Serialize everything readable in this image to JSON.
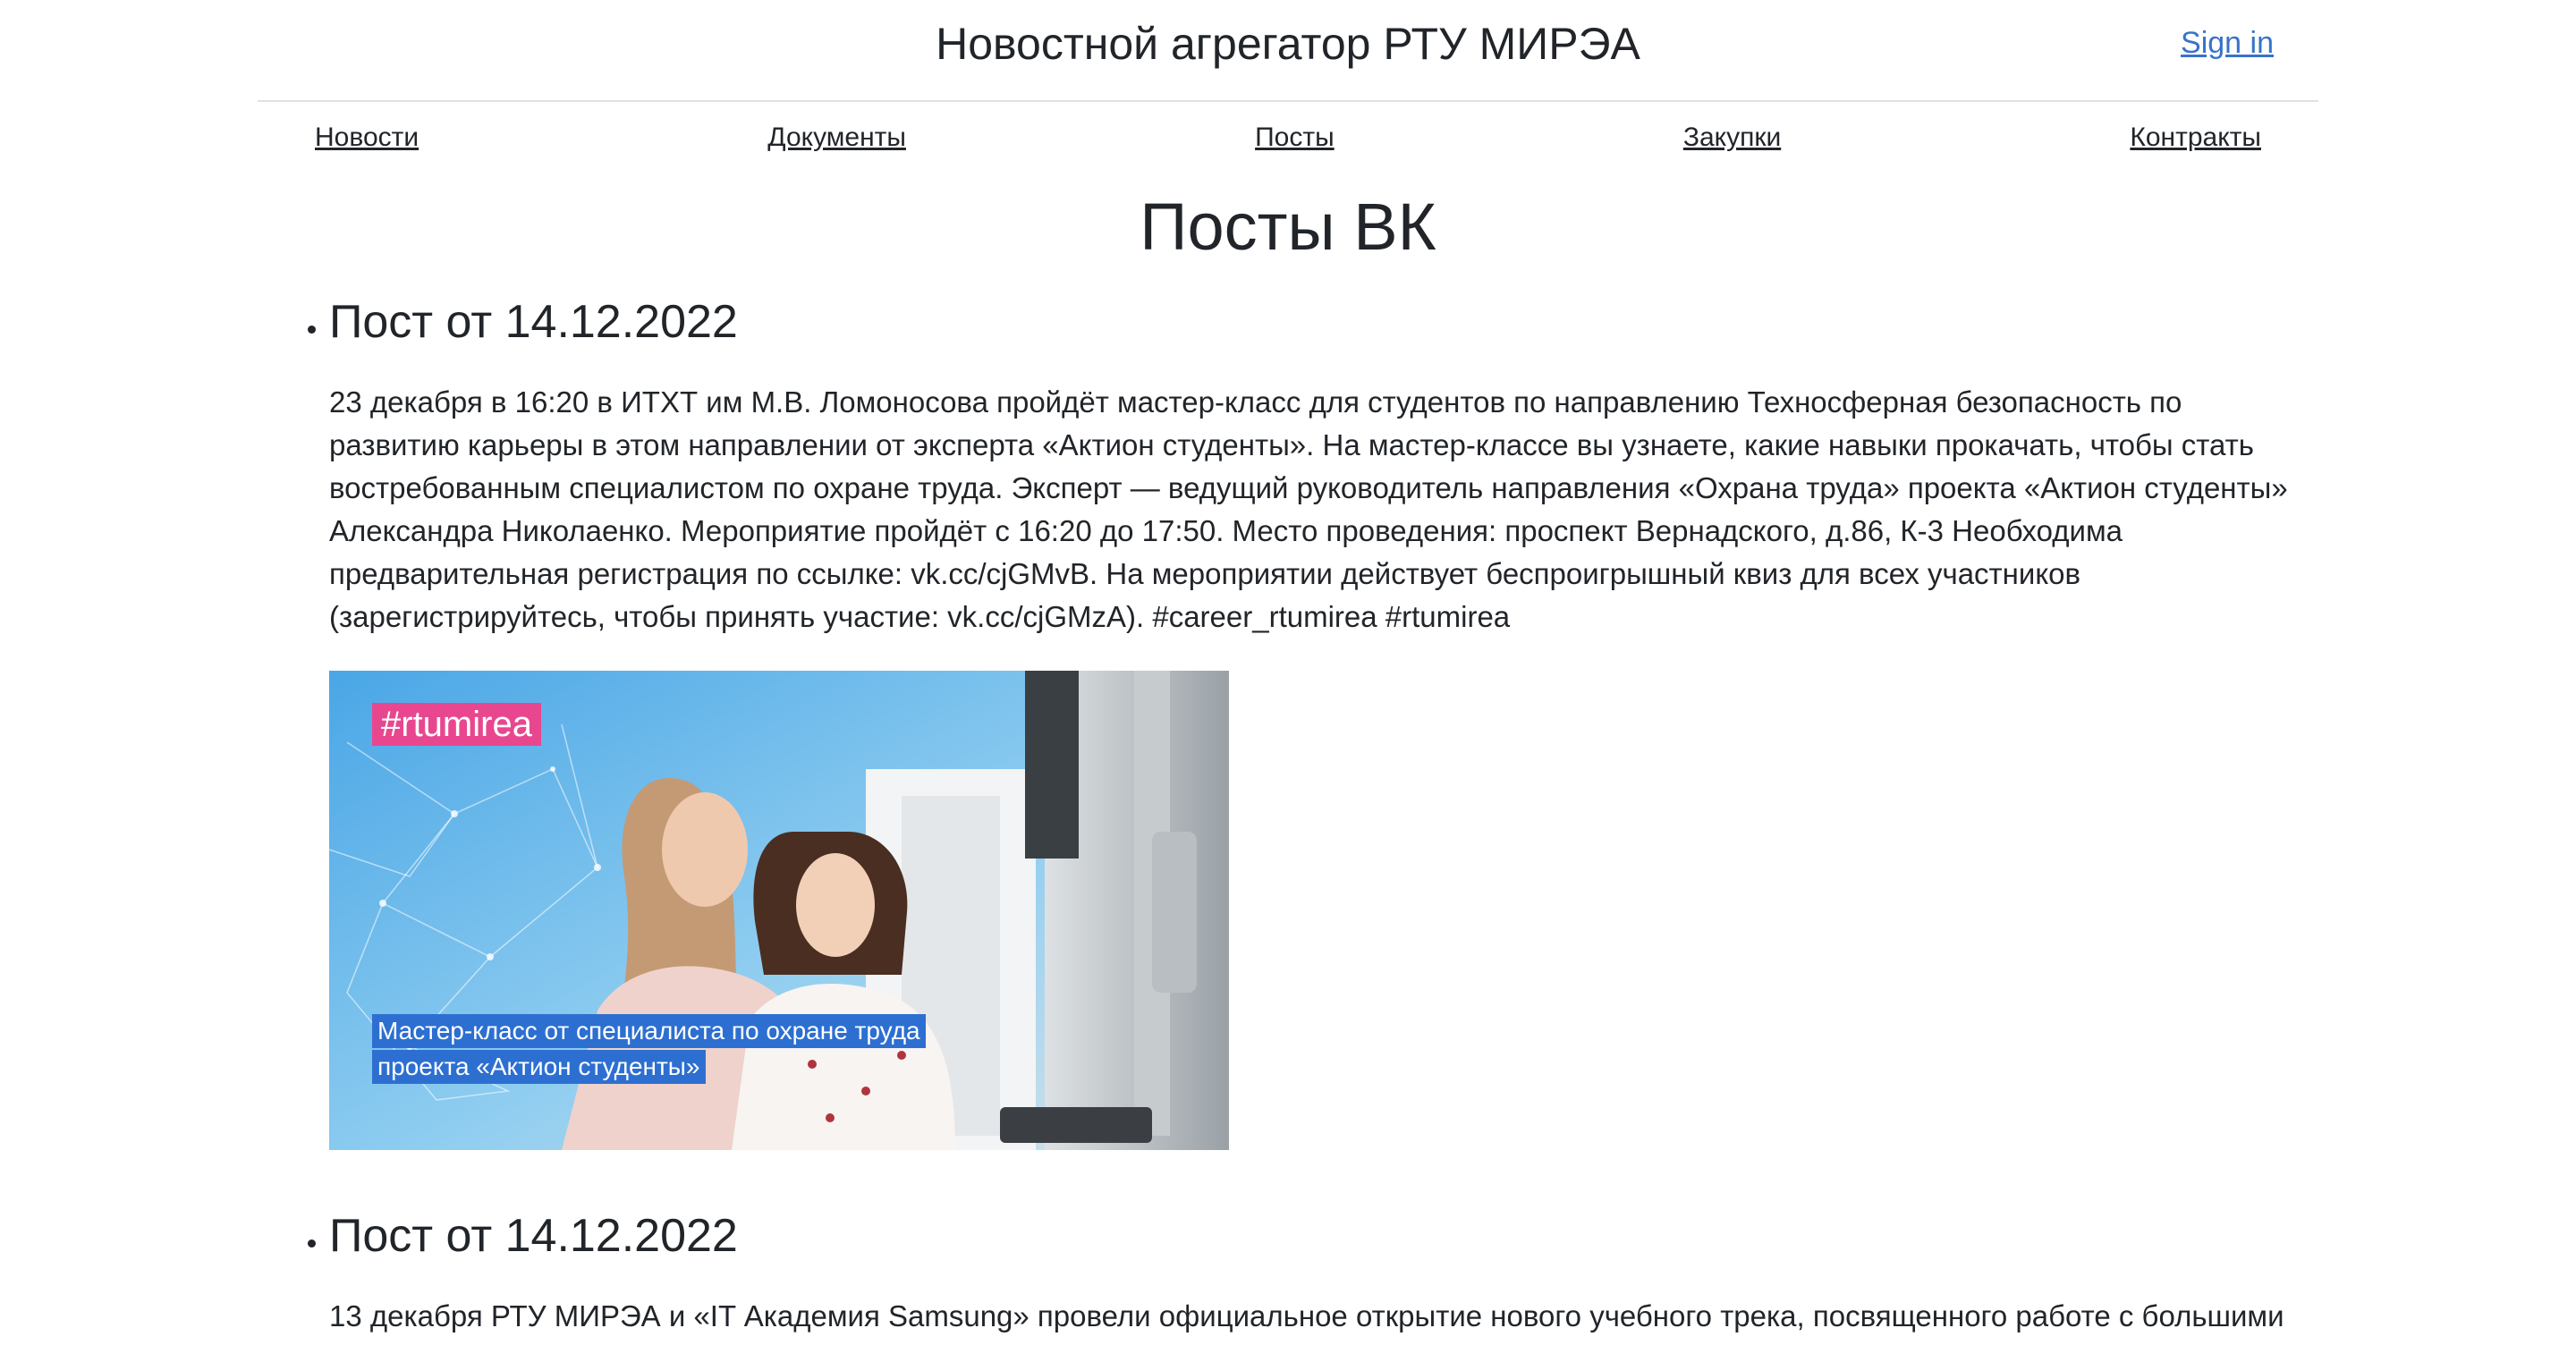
{
  "header": {
    "title": "Новостной агрегатор РТУ МИРЭА",
    "sign_in": "Sign in"
  },
  "nav": {
    "items": [
      {
        "label": "Новости"
      },
      {
        "label": "Документы"
      },
      {
        "label": "Посты"
      },
      {
        "label": "Закупки"
      },
      {
        "label": "Контракты"
      }
    ]
  },
  "main": {
    "heading": "Посты ВК",
    "posts": [
      {
        "title": "Пост от 14.12.2022",
        "text": "23 декабря в 16:20 в ИТХТ им М.В. Ломоносова пройдёт мастер-класс для студентов по направлению Техносферная безопасность по развитию карьеры в этом направлении от эксперта «Актион студенты». На мастер-классе вы узнаете, какие навыки прокачать, чтобы стать востребованным специалистом по охране труда. Эксперт — ведущий руководитель направления «Охрана труда» проекта «Актион студенты» Александра Николаенко. Мероприятие пройдёт с 16:20 до 17:50. Место проведения: проспект Вернадского, д.86, К-3 Необходима предварительная регистрация по ссылке: vk.cc/cjGMvB. На мероприятии действует беспроигрышный квиз для всех участников (зарегистрируйтесь, чтобы принять участие: vk.cc/cjGMzA). #career_rtumirea #rtumirea",
        "image": {
          "tag": "#rtumirea",
          "caption_line1": "Мастер-класс от специалиста по охране труда",
          "caption_line2": "проекта «Актион студенты»"
        }
      },
      {
        "title": "Пост от 14.12.2022",
        "text": "13 декабря РТУ МИРЭА и «IT Академия Samsung» провели официальное открытие нового учебного трека, посвященного работе с большими"
      }
    ]
  },
  "colors": {
    "link": "#3873c8",
    "text": "#212529",
    "tag_bg": "#e8478f",
    "caption_bg": "#2d6fd1"
  }
}
